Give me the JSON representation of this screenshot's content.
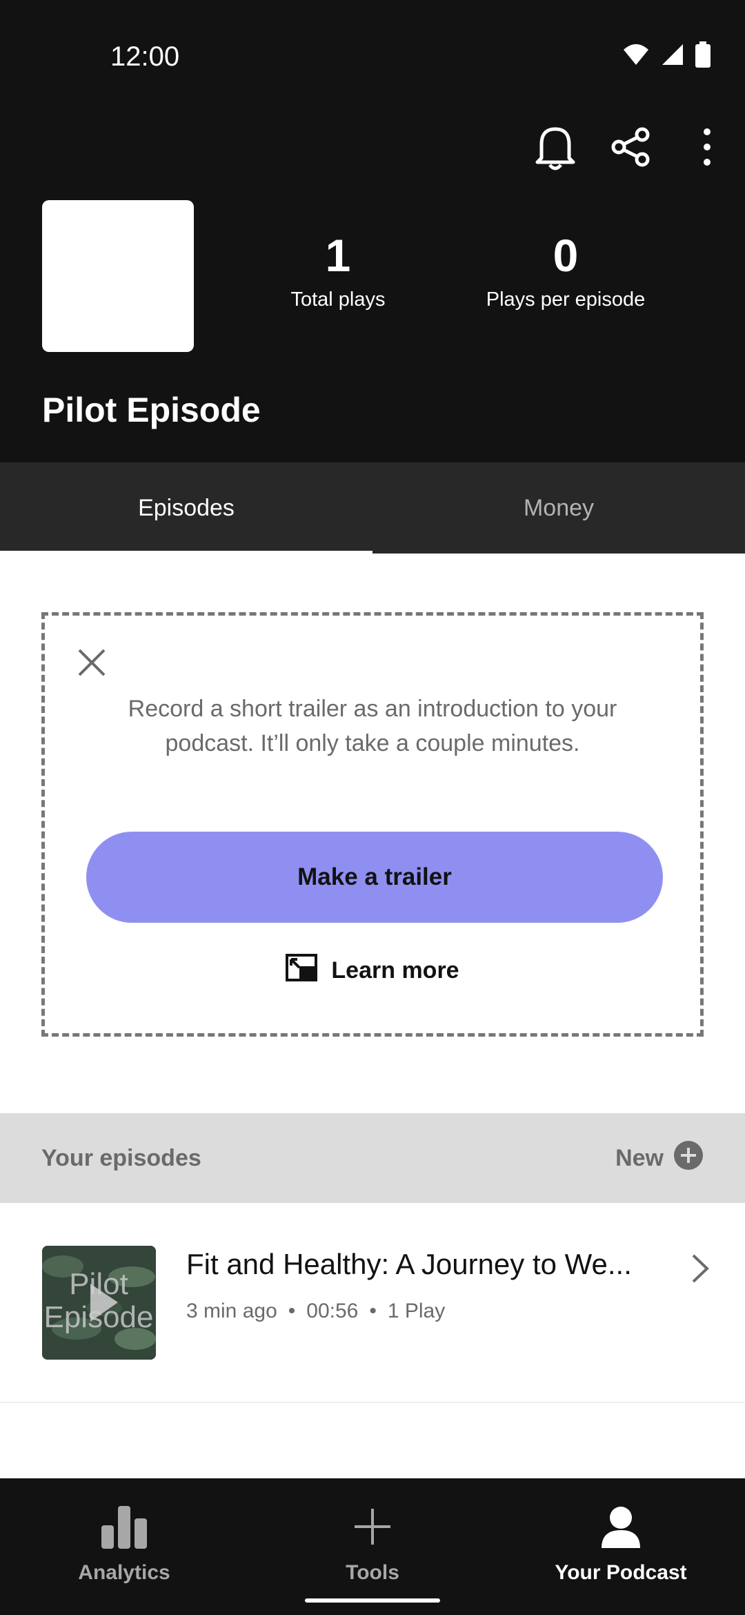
{
  "status_bar": {
    "time": "12:00"
  },
  "header": {
    "podcast_title": "Pilot Episode",
    "stats": [
      {
        "value": "1",
        "label": "Total plays"
      },
      {
        "value": "0",
        "label": "Plays per episode"
      }
    ],
    "actions": [
      "bell-icon",
      "share-icon",
      "more-vertical-icon"
    ]
  },
  "tabs": [
    {
      "label": "Episodes",
      "active": true
    },
    {
      "label": "Money",
      "active": false
    }
  ],
  "trailer_card": {
    "text": "Record a short trailer as an introduction to your podcast. It’ll only take a couple minutes.",
    "cta_label": "Make a trailer",
    "learn_more_label": "Learn more"
  },
  "episodes_section": {
    "title": "Your episodes",
    "new_label": "New",
    "episodes": [
      {
        "title": "Fit and Healthy: A Journey to We...",
        "time_ago": "3 min ago",
        "duration": "00:56",
        "plays": "1 Play",
        "thumb_text_1": "Pilot",
        "thumb_text_2": "Episode"
      }
    ]
  },
  "bottom_nav": [
    {
      "label": "Analytics",
      "icon": "analytics-icon",
      "active": false
    },
    {
      "label": "Tools",
      "icon": "plus-icon",
      "active": false
    },
    {
      "label": "Your Podcast",
      "icon": "person-icon",
      "active": true
    }
  ],
  "colors": {
    "header_bg": "#121212",
    "tab_bg": "#282828",
    "cta_bg": "#8f8ff2",
    "section_bg": "#dcdcdc"
  }
}
